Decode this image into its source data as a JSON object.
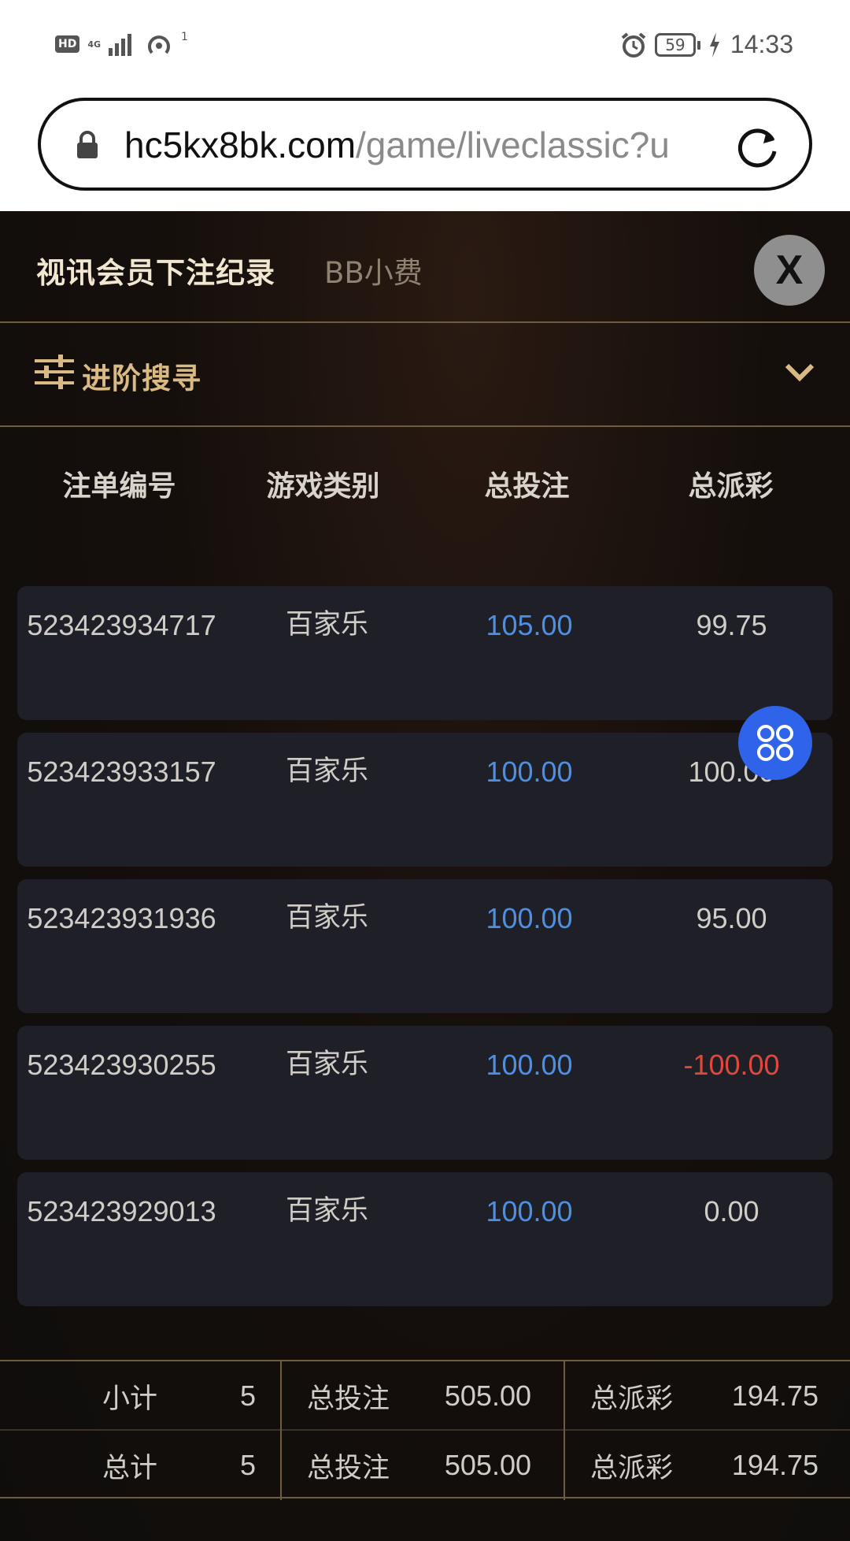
{
  "status_bar": {
    "hd": "HD",
    "network": "4G",
    "hotspot_count": "1",
    "battery": "59",
    "time": "14:33"
  },
  "browser": {
    "url_host": "hc5kx8bk.com",
    "url_path": "/game/liveclassic?u"
  },
  "header": {
    "tab_active": "视讯会员下注纪录",
    "tab_inactive": "BB小费",
    "close_label": "X"
  },
  "advanced_search": {
    "label": "进阶搜寻"
  },
  "table": {
    "columns": [
      "注单编号",
      "游戏类别",
      "总投注",
      "总派彩"
    ],
    "rows": [
      {
        "id": "523423934717",
        "game": "百家乐",
        "bet": "105.00",
        "payout": "99.75"
      },
      {
        "id": "523423933157",
        "game": "百家乐",
        "bet": "100.00",
        "payout": "100.00"
      },
      {
        "id": "523423931936",
        "game": "百家乐",
        "bet": "100.00",
        "payout": "95.00"
      },
      {
        "id": "523423930255",
        "game": "百家乐",
        "bet": "100.00",
        "payout": "-100.00"
      },
      {
        "id": "523423929013",
        "game": "百家乐",
        "bet": "100.00",
        "payout": "0.00"
      }
    ]
  },
  "summary": {
    "subtotal": {
      "label": "小计",
      "count": "5",
      "bet_label": "总投注",
      "bet": "505.00",
      "payout_label": "总派彩",
      "payout": "194.75"
    },
    "total": {
      "label": "总计",
      "count": "5",
      "bet_label": "总投注",
      "bet": "505.00",
      "payout_label": "总派彩",
      "payout": "194.75"
    }
  },
  "colors": {
    "accent_gold": "#d9b984",
    "bet_blue": "#4c8fe3",
    "negative_red": "#e0483c",
    "fab_blue": "#2f64ea"
  }
}
